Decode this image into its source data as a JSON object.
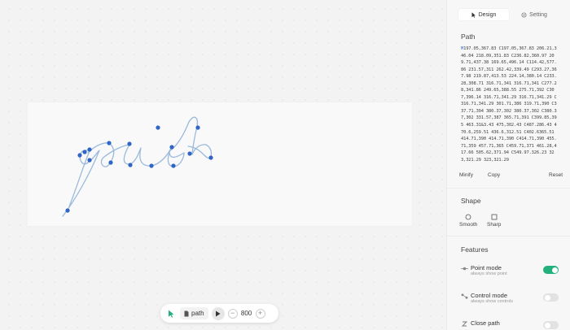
{
  "toolbar": {
    "file_name": "path",
    "zoom": "800",
    "minus_label": "−",
    "plus_label": "+"
  },
  "panel": {
    "tabs": [
      {
        "label": "Design",
        "icon": "cursor-icon",
        "active": true
      },
      {
        "label": "Setting",
        "icon": "gear-icon",
        "active": false
      }
    ],
    "path_section": {
      "title": "Path",
      "move_cmd": "M",
      "path_string": "197.05,367.83 C197.05,367.83 206.21,346.04 218.09,351.83 C236.82,360.97 209.71,437.38 169.65,496.14 C114.42,577.86 231.57,311 262.42,339.49 C293.27,367.98 219.87,413.53 224.14,380.14 C233.28,308.71 316.71,341 316.71,341 C277.28,341.86 249.65,388.55 275.71,392 C307,396.14 316.71,341.29 316.71,341.29 C316.71,341.29 301.71,386 319.71,390 C337.71,394 380.37,302 380.37,302 C380.37,302 331.57,387 365.71,391 C399.85,395 463.31&3.43 475,302.43 C487.286.43 470.6,259.51 436.6,312.51 C402.6365.51 414.71,390 414.71,390 C414.71,390 455.71,359 457.71,365 C459.71,371 461.28,417.66 505.62,371.94 C549.97.326.23 323,321.29 323,321.29",
      "actions": {
        "minify": "Minify",
        "copy": "Copy",
        "reset": "Reset"
      }
    },
    "shape_section": {
      "title": "Shape",
      "options": [
        {
          "label": "Smooth",
          "icon": "circle-icon"
        },
        {
          "label": "Sharp",
          "icon": "square-icon"
        }
      ]
    },
    "features_section": {
      "title": "Features",
      "items": [
        {
          "title": "Point mode",
          "subtitle": "always show point",
          "enabled": true,
          "icon": "point-mode-icon"
        },
        {
          "title": "Control mode",
          "subtitle": "always show controls",
          "enabled": false,
          "icon": "control-mode-icon"
        },
        {
          "title": "Close path",
          "subtitle": "",
          "enabled": false,
          "icon": "close-path-icon"
        }
      ]
    }
  },
  "colors": {
    "accent": "#3c72d6",
    "path_stroke": "#9ab9dc",
    "anchor": "#2f65c4",
    "toggle_on": "#22b07d"
  }
}
